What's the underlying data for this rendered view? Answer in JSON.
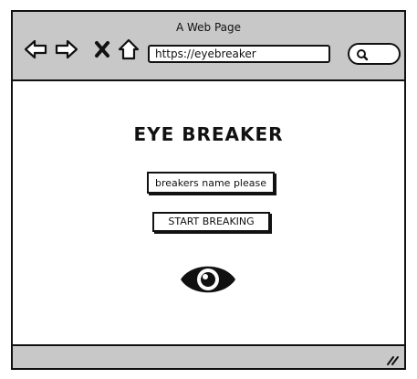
{
  "window": {
    "title": "A Web Page"
  },
  "toolbar": {
    "icons": [
      "back-arrow-icon",
      "forward-arrow-icon",
      "close-x-icon",
      "home-icon",
      "search-icon"
    ],
    "url": "https://eyebreaker"
  },
  "main": {
    "title": "EYE BREAKER",
    "name_input_placeholder": "breakers name please",
    "start_button_label": "START BREAKING",
    "logo_icon": "eye-icon"
  },
  "colors": {
    "chrome_gray": "#c8c8c8",
    "ink": "#111111",
    "background": "#ffffff"
  }
}
